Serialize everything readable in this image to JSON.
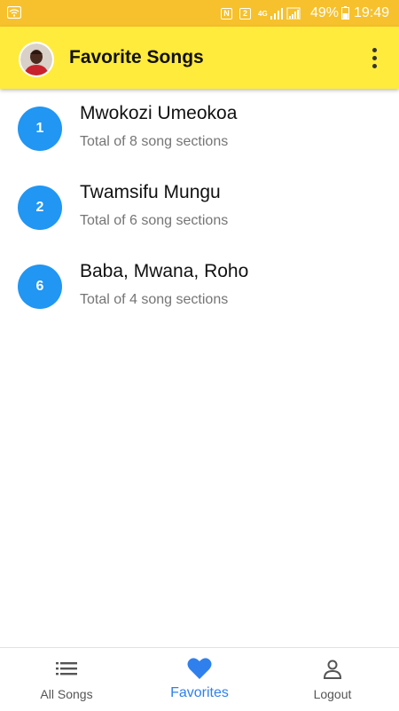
{
  "status_bar": {
    "sim_label": "2",
    "network": "4G",
    "battery_percent": "49%",
    "time": "19:49"
  },
  "app_bar": {
    "title": "Favorite Songs",
    "menu_icon": "overflow-menu-icon",
    "avatar_icon": "user-avatar"
  },
  "songs": [
    {
      "number": "1",
      "title": "Mwokozi Umeokoa",
      "subtitle": "Total of 8 song sections"
    },
    {
      "number": "2",
      "title": "Twamsifu Mungu",
      "subtitle": "Total of 6 song sections"
    },
    {
      "number": "6",
      "title": "Baba, Mwana, Roho",
      "subtitle": "Total of 4 song sections"
    }
  ],
  "bottom_nav": [
    {
      "label": "All Songs",
      "icon": "list-icon",
      "active": false
    },
    {
      "label": "Favorites",
      "icon": "heart-icon",
      "active": true
    },
    {
      "label": "Logout",
      "icon": "person-icon",
      "active": false
    }
  ],
  "colors": {
    "status_bar": "#f6c12c",
    "app_bar": "#ffeb3b",
    "accent": "#2196f3",
    "active_nav": "#2f80ed"
  }
}
